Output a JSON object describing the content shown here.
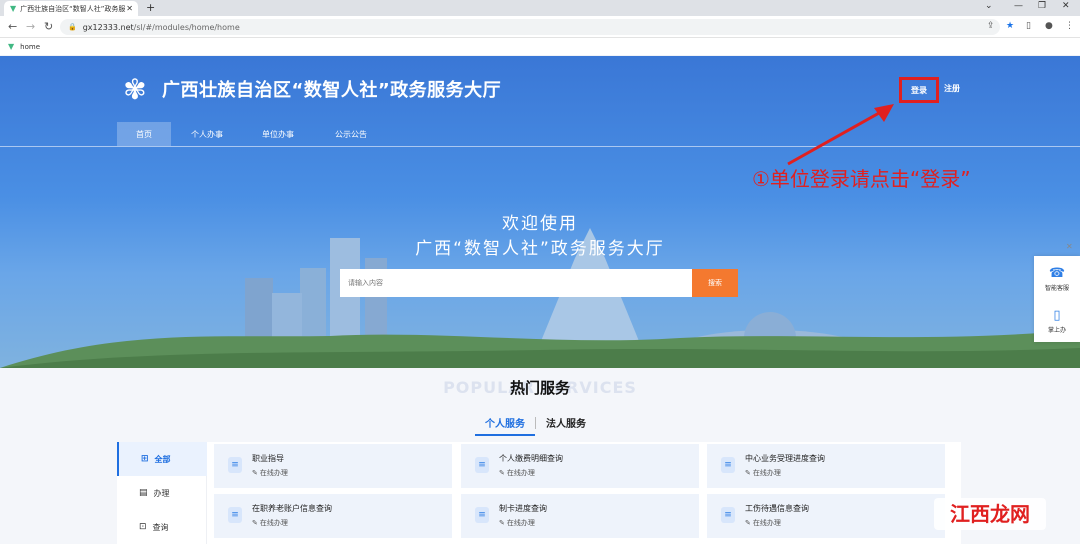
{
  "browser": {
    "tab_title": "广西壮族自治区“数智人社”政务服...",
    "url_host": "gx12333.net",
    "url_path": "/sl/#/modules/home/home",
    "bookmark": "home"
  },
  "header": {
    "title": "广西壮族自治区“数智人社”政务服务大厅",
    "login": "登录",
    "register": "注册"
  },
  "nav": {
    "items": [
      "首页",
      "个人办事",
      "单位办事",
      "公示公告"
    ]
  },
  "annotation": "①单位登录请点击“登录”",
  "hero": {
    "welcome_line1": "欢迎使用",
    "welcome_line2": "广西“数智人社”政务服务大厅",
    "search_placeholder": "请输入内容",
    "search_button": "搜索"
  },
  "float_panel": {
    "items": [
      "智能客服",
      "掌上办"
    ]
  },
  "hot_services": {
    "bg_title": "POPULAR SERVICES",
    "title": "热门服务",
    "tabs": [
      "个人服务",
      "法人服务"
    ],
    "categories": [
      "全部",
      "办理",
      "查询"
    ],
    "cards": [
      {
        "title": "职业指导",
        "sub": "在线办理"
      },
      {
        "title": "个人缴费明细查询",
        "sub": "在线办理"
      },
      {
        "title": "中心业务受理进度查询",
        "sub": "在线办理"
      },
      {
        "title": "在职养老账户信息查询",
        "sub": "在线办理"
      },
      {
        "title": "制卡进度查询",
        "sub": "在线办理"
      },
      {
        "title": "工伤待遇信息查询",
        "sub": "在线办理"
      }
    ]
  },
  "watermark": "江西龙网",
  "colors": {
    "accent": "#1f6fe0",
    "search_button": "#f4792f",
    "annotation": "#e02020"
  }
}
